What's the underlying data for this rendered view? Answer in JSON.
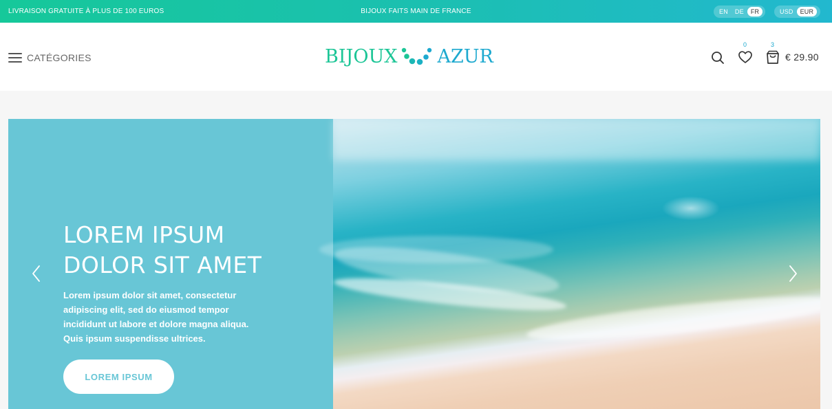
{
  "topbar": {
    "shipping_notice": "LIVRAISON GRATUITE À PLUS DE 100 EUROS",
    "tagline": "BIJOUX FAITS MAIN DE FRANCE",
    "languages": [
      "EN",
      "DE",
      "FR"
    ],
    "selected_language": "FR",
    "currencies": [
      "USD",
      "EUR"
    ],
    "selected_currency": "EUR"
  },
  "header": {
    "menu_label": "CATÉGORIES",
    "logo": {
      "word1": "BIJOUX",
      "word2": "AZUR"
    },
    "wishlist_count": "0",
    "cart_count": "3",
    "cart_total": "€ 29.90"
  },
  "hero": {
    "title_line1": "LOREM IPSUM",
    "title_line2": "DOLOR SIT AMET",
    "text": "Lorem ipsum dolor sit amet, consectetur adipiscing elit, sed do eiusmod tempor incididunt ut labore et dolore magna aliqua. Quis ipsum suspendisse ultrices.",
    "button_label": "LOREM IPSUM"
  },
  "colors": {
    "brand_green": "#1cc596",
    "brand_blue": "#1da9cf",
    "hero_panel": "#68c6d6"
  },
  "icons": [
    "menu-icon",
    "search-icon",
    "heart-icon",
    "shopping-bag-icon",
    "chevron-left-icon",
    "chevron-right-icon"
  ]
}
